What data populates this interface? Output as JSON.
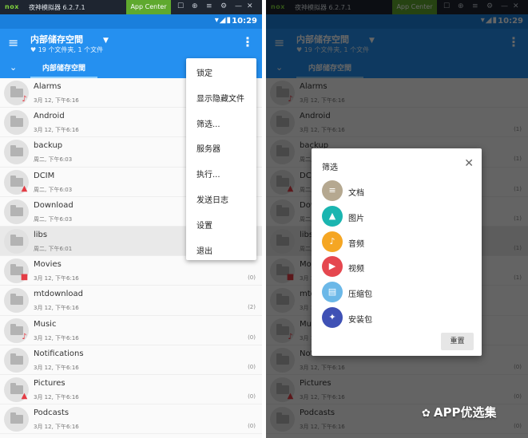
{
  "emulator": {
    "logo": "nox",
    "title": "夜神模拟器 6.2.7.1",
    "app_center": "App Center",
    "controls": [
      "☐",
      "⊕",
      "≡",
      "⚙",
      "—",
      "☐",
      "✕"
    ]
  },
  "status_bar": {
    "time": "10:29",
    "icons": "▾◢▮"
  },
  "app_bar": {
    "menu_icon": "≡",
    "title": "内部储存空間",
    "subtitle": "♥ 19 个文件夹, 1 个文件",
    "dropdown_icon": "▼",
    "more_icon": "⋮"
  },
  "tab_bar": {
    "chevron_icon": "⌄",
    "tab_label": "内部储存空間"
  },
  "files": [
    {
      "name": "Alarms",
      "date": "3月 12, 下午6:16",
      "count": "",
      "badge": "♪"
    },
    {
      "name": "Android",
      "date": "3月 12, 下午6:16",
      "count": "",
      "badge": ""
    },
    {
      "name": "backup",
      "date": "周二, 下午6:03",
      "count": "",
      "badge": ""
    },
    {
      "name": "DCIM",
      "date": "周二, 下午6:03",
      "count": "",
      "badge": "▲"
    },
    {
      "name": "Download",
      "date": "周二, 下午6:03",
      "count": "",
      "badge": ""
    },
    {
      "name": "libs",
      "date": "周二, 下午6:01",
      "count": "",
      "badge": ""
    },
    {
      "name": "Movies",
      "date": "3月 12, 下午6:16",
      "count": "(0)",
      "badge": "■"
    },
    {
      "name": "mtdownload",
      "date": "3月 12, 下午6:16",
      "count": "(2)",
      "badge": ""
    },
    {
      "name": "Music",
      "date": "3月 12, 下午6:16",
      "count": "(0)",
      "badge": "♪"
    },
    {
      "name": "Notifications",
      "date": "3月 12, 下午6:16",
      "count": "(0)",
      "badge": ""
    },
    {
      "name": "Pictures",
      "date": "3月 12, 下午6:16",
      "count": "(0)",
      "badge": "▲"
    },
    {
      "name": "Podcasts",
      "date": "3月 12, 下午6:16",
      "count": "(0)",
      "badge": ""
    }
  ],
  "right_counts": [
    "",
    "(1)",
    "(1)",
    "(1)",
    "(1)",
    "(1)",
    "(1)",
    "",
    "",
    "(0)",
    "(0)",
    "(0)"
  ],
  "overflow_menu": [
    "锁定",
    "显示隐藏文件",
    "筛选...",
    "服务器",
    "执行...",
    "发送日志",
    "设置",
    "退出"
  ],
  "filter_dialog": {
    "title": "筛选",
    "close_icon": "✕",
    "options": [
      {
        "label": "文档",
        "color": "#b5a890",
        "icon": "≡"
      },
      {
        "label": "图片",
        "color": "#1ab5b0",
        "icon": "▲"
      },
      {
        "label": "音频",
        "color": "#f5a623",
        "icon": "♪"
      },
      {
        "label": "视频",
        "color": "#e5474f",
        "icon": "▶"
      },
      {
        "label": "压缩包",
        "color": "#6bb8e8",
        "icon": "▤"
      },
      {
        "label": "安装包",
        "color": "#3f51b5",
        "icon": "✦"
      }
    ],
    "reset_label": "重置"
  },
  "watermark": {
    "icon": "✿",
    "text": "APP优选集"
  }
}
